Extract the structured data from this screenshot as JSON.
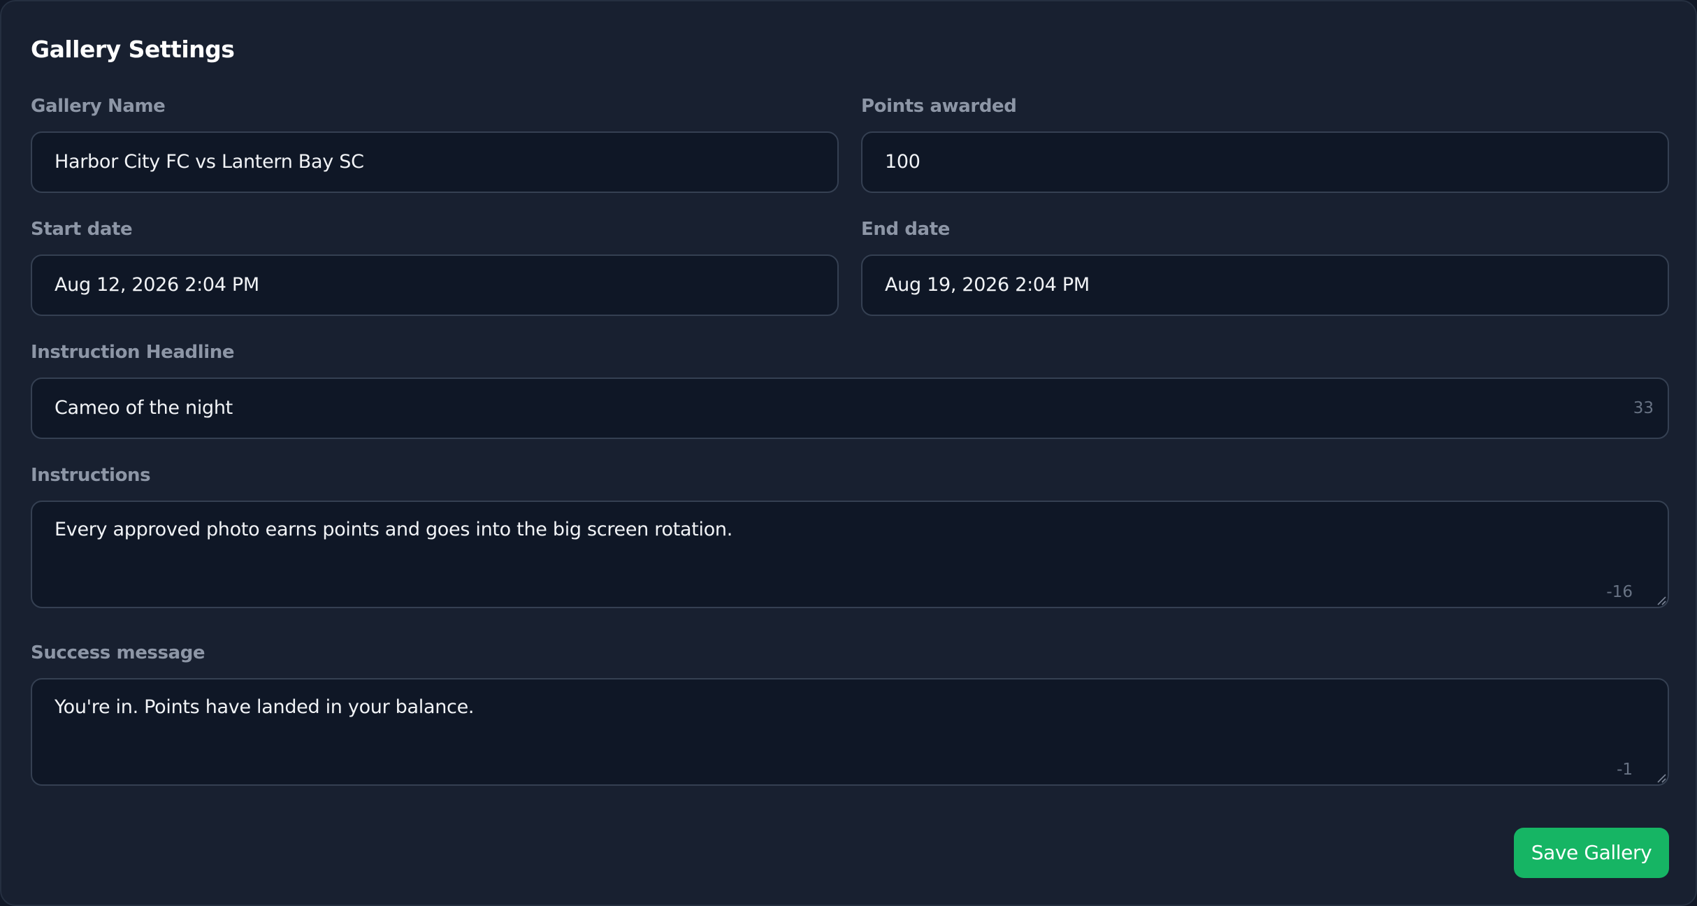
{
  "page": {
    "title": "Gallery Settings"
  },
  "fields": {
    "gallery_name": {
      "label": "Gallery Name",
      "value": "Harbor City FC vs Lantern Bay SC"
    },
    "points_awarded": {
      "label": "Points awarded",
      "value": "100"
    },
    "start_date": {
      "label": "Start date",
      "value": "Aug 12, 2026 2:04 PM"
    },
    "end_date": {
      "label": "End date",
      "value": "Aug 19, 2026 2:04 PM"
    },
    "instruction_headline": {
      "label": "Instruction Headline",
      "value": "Cameo of the night",
      "counter": "33"
    },
    "instructions": {
      "label": "Instructions",
      "value": "Every approved photo earns points and goes into the big screen rotation.",
      "counter": "-16"
    },
    "success_message": {
      "label": "Success message",
      "value": "You're in. Points have landed in your balance.",
      "counter": "-1"
    }
  },
  "actions": {
    "save_label": "Save Gallery"
  },
  "colors": {
    "background": "#182030",
    "field_background": "#0f1726",
    "field_border": "#354052",
    "label": "#8d96a6",
    "accent": "#16b564"
  },
  "icons": {
    "resize_handle": "resize-grip-icon"
  }
}
